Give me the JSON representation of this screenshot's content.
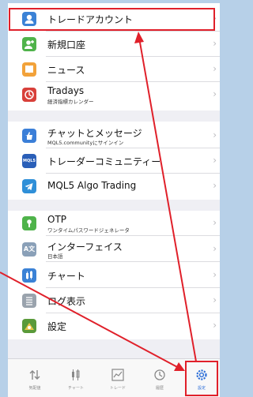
{
  "menu": {
    "group1": [
      {
        "title": "トレードアカウント",
        "icon": "account-icon",
        "color": "#3b82d6"
      },
      {
        "title": "新規口座",
        "icon": "new-account-icon",
        "color": "#4fb34a"
      },
      {
        "title": "ニュース",
        "icon": "news-icon",
        "color": "#f2a23a"
      },
      {
        "title": "Tradays",
        "subtitle": "経済指標カレンダー",
        "icon": "tradays-icon",
        "color": "#d8403a"
      }
    ],
    "group2": [
      {
        "title": "チャットとメッセージ",
        "subtitle": "MQL5.communityにサインイン",
        "icon": "chat-icon",
        "color": "#3b7fd8"
      },
      {
        "title": "トレーダーコミュニティー",
        "icon": "mql5-icon",
        "color": "#2a5fb8"
      },
      {
        "title": "MQL5 Algo Trading",
        "icon": "telegram-icon",
        "color": "#2f8fd8"
      }
    ],
    "group3": [
      {
        "title": "OTP",
        "subtitle": "ワンタイムパスワードジェネレータ",
        "icon": "otp-icon",
        "color": "#4fb34a"
      },
      {
        "title": "インターフェイス",
        "subtitle": "日本語",
        "icon": "interface-icon",
        "color": "#8aa0b8"
      },
      {
        "title": "チャート",
        "icon": "chart-icon",
        "color": "#3b82d6"
      },
      {
        "title": "ログ表示",
        "icon": "log-icon",
        "color": "#9aa3ad"
      },
      {
        "title": "設定",
        "icon": "settings-app-icon",
        "color": "#5a9a3a"
      }
    ],
    "chevron": "›"
  },
  "tabbar": {
    "tabs": [
      {
        "label": "気配値",
        "icon": "quotes-icon"
      },
      {
        "label": "チャート",
        "icon": "chart-tab-icon"
      },
      {
        "label": "トレード",
        "icon": "trade-icon"
      },
      {
        "label": "履歴",
        "icon": "history-icon"
      },
      {
        "label": "設定",
        "icon": "settings-icon",
        "active": true
      }
    ]
  },
  "colors": {
    "accent": "#2e6fd8",
    "annotation": "#e0202a"
  }
}
